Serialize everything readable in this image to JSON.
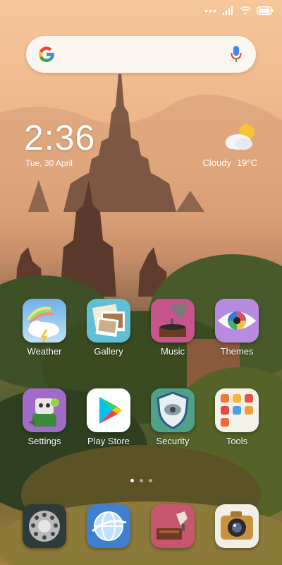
{
  "status_bar": {
    "signal_dots": "•••",
    "icons": [
      "signal-icon",
      "wifi-icon",
      "battery-icon"
    ]
  },
  "search": {
    "icons": [
      "google-g-icon",
      "microphone-icon"
    ]
  },
  "clock": {
    "time": "2:36",
    "date": "Tue, 30 April"
  },
  "weather": {
    "condition": "Cloudy",
    "temperature": "19°C",
    "icon": "partly-cloudy-icon"
  },
  "apps": [
    {
      "label": "Weather",
      "icon": "weather-app-icon"
    },
    {
      "label": "Gallery",
      "icon": "gallery-app-icon"
    },
    {
      "label": "Music",
      "icon": "music-app-icon"
    },
    {
      "label": "Themes",
      "icon": "themes-app-icon"
    },
    {
      "label": "Settings",
      "icon": "settings-app-icon"
    },
    {
      "label": "Play Store",
      "icon": "play-store-app-icon"
    },
    {
      "label": "Security",
      "icon": "security-app-icon"
    },
    {
      "label": "Tools",
      "icon": "tools-app-icon"
    }
  ],
  "dock": [
    {
      "icon": "phone-dock-icon"
    },
    {
      "icon": "browser-dock-icon"
    },
    {
      "icon": "messages-dock-icon"
    },
    {
      "icon": "camera-dock-icon"
    }
  ],
  "page_indicator": {
    "pages": 3,
    "current": 1
  },
  "colors": {
    "google_blue": "#4285F4",
    "google_red": "#EA4335",
    "google_yellow": "#FBBC05",
    "google_green": "#34A853"
  }
}
